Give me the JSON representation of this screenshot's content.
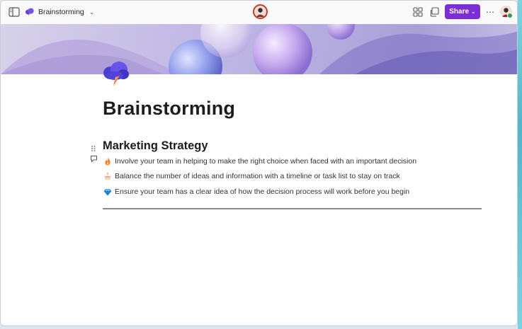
{
  "titlebar": {
    "doc_name": "Brainstorming",
    "share_label": "Share"
  },
  "page": {
    "title": "Brainstorming"
  },
  "section": {
    "heading": "Marketing Strategy",
    "bullets": [
      {
        "icon": "fire-emoji-icon",
        "text": "Involve your team in helping to make the right choice when faced with an important decision"
      },
      {
        "icon": "cake-emoji-icon",
        "text": "Balance the number of ideas and information with a timeline or task list to stay on track"
      },
      {
        "icon": "gem-emoji-icon",
        "text": "Ensure your team has a clear idea of how the decision process will work before you begin"
      }
    ]
  },
  "colors": {
    "accent": "#7b2ed6",
    "presence": "#2ea043"
  }
}
